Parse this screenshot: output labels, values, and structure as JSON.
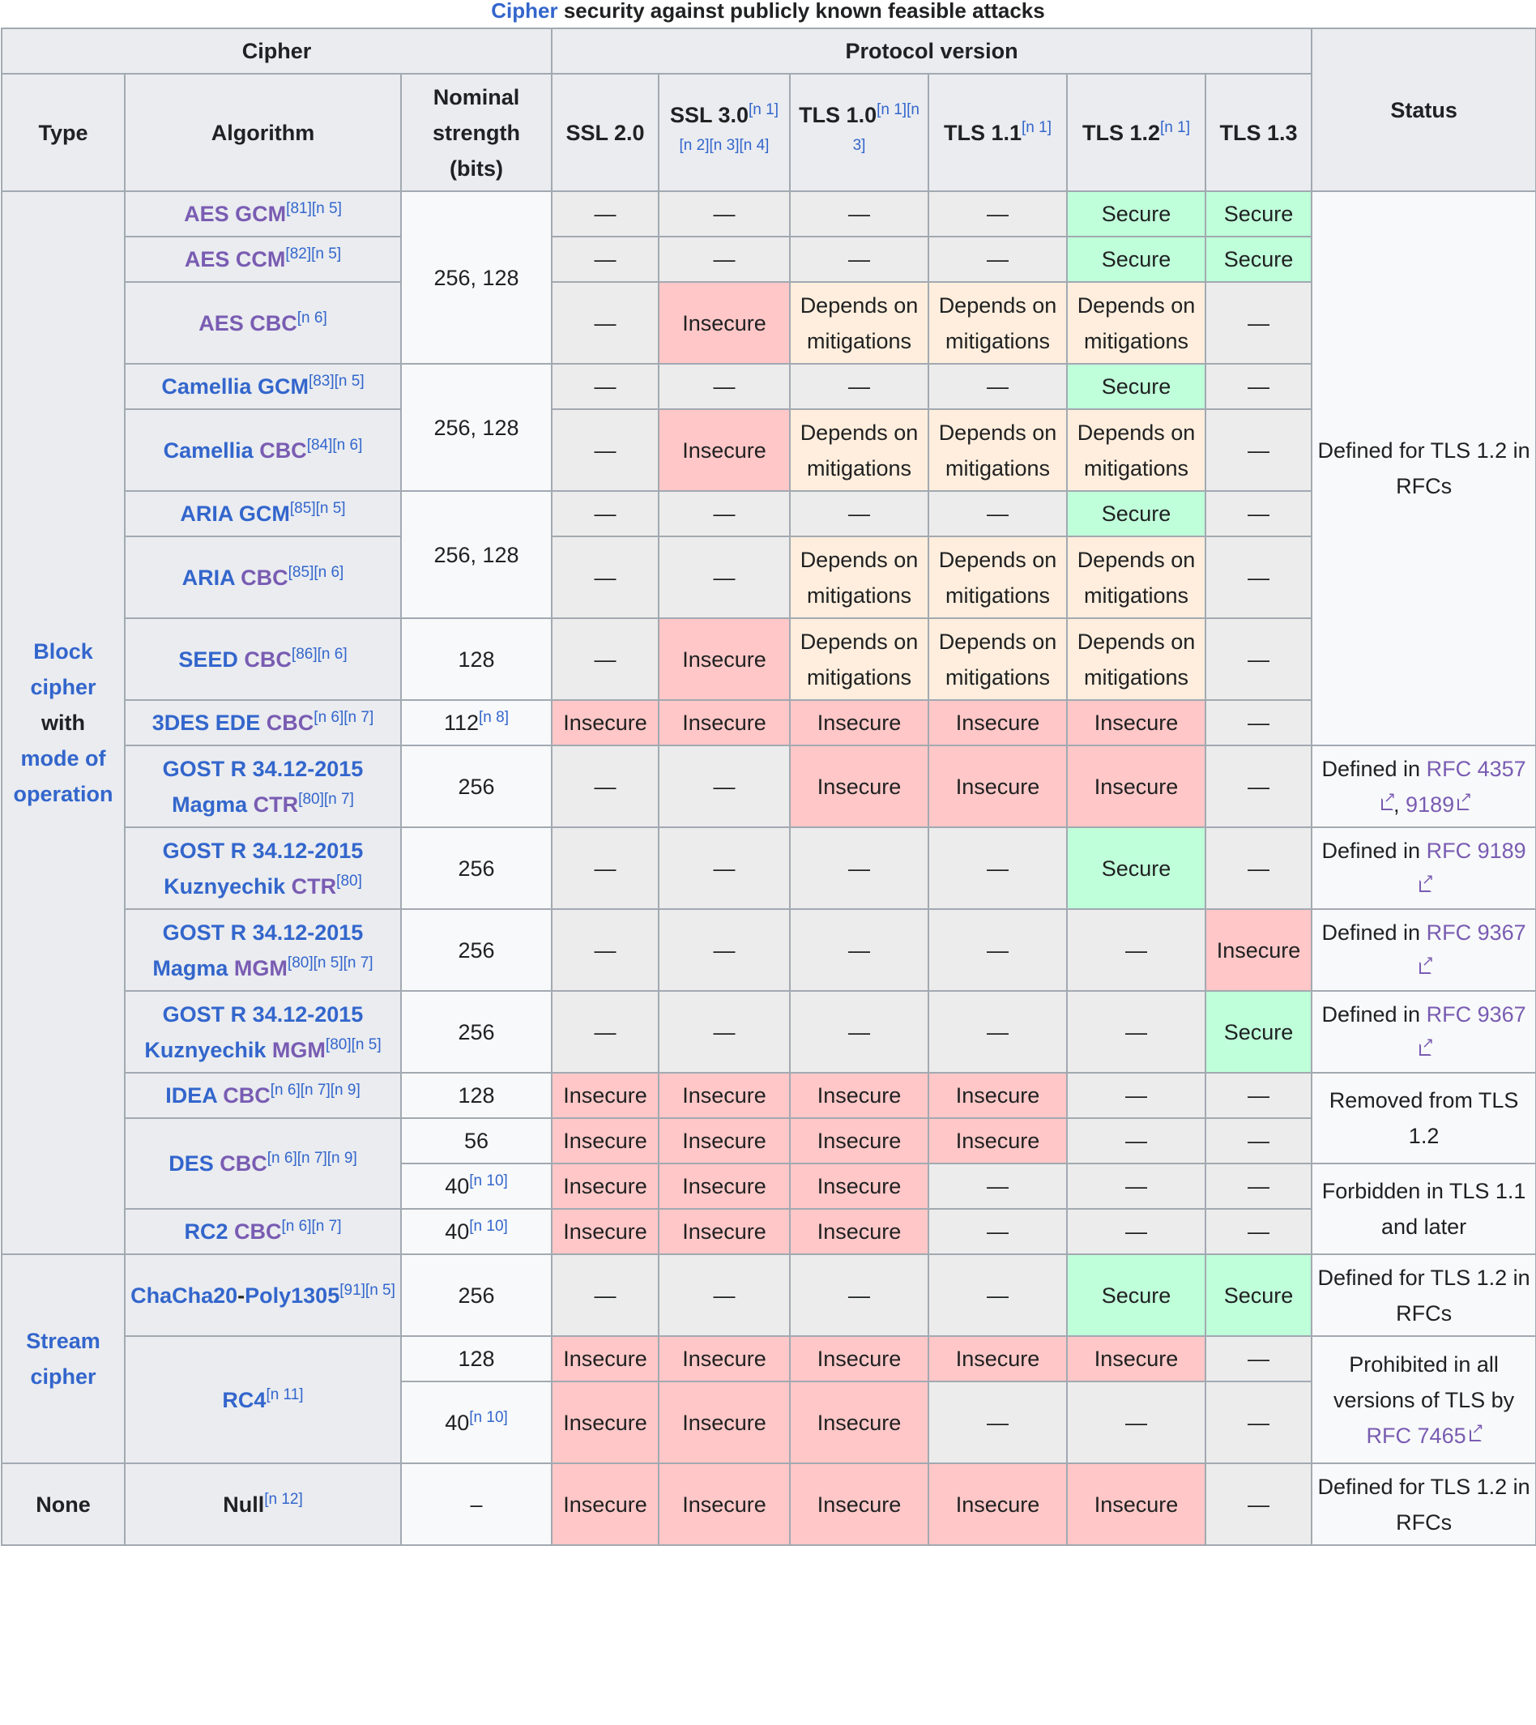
{
  "caption": {
    "link": "Cipher",
    "text": " security against publicly known feasible attacks"
  },
  "headers": {
    "cipher": "Cipher",
    "protocol_version": "Protocol version",
    "status": "Status",
    "type": "Type",
    "algorithm": "Algorithm",
    "strength": "Nominal strength (bits)",
    "versions": [
      {
        "name": "SSL 2.0",
        "refs": []
      },
      {
        "name": "SSL 3.0",
        "refs": [
          "[n 1]",
          "[n 2]",
          "[n 3]",
          "[n 4]"
        ]
      },
      {
        "name": "TLS 1.0",
        "refs": [
          "[n 1]",
          "[n 3]"
        ]
      },
      {
        "name": "TLS 1.1",
        "refs": [
          "[n 1]"
        ]
      },
      {
        "name": "TLS 1.2",
        "refs": [
          "[n 1]"
        ]
      },
      {
        "name": "TLS 1.3",
        "refs": []
      }
    ]
  },
  "types": {
    "block": [
      "Block",
      "cipher",
      "with",
      "mode of",
      "operation"
    ],
    "stream": [
      "Stream",
      "cipher"
    ],
    "none": "None"
  },
  "values": {
    "dash": "—",
    "secure": "Secure",
    "insecure": "Insecure",
    "depends": "Depends on mitigations",
    "en_dash": "–"
  },
  "rows": [
    {
      "algo": [
        {
          "t": "AES",
          "c": "vis"
        },
        {
          "t": " GCM",
          "c": "vis"
        }
      ],
      "refs": [
        "[81]",
        "[n 5]"
      ],
      "strength": "256, 128",
      "cells": [
        "na",
        "na",
        "na",
        "na",
        "sec",
        "sec"
      ]
    },
    {
      "algo": [
        {
          "t": "AES",
          "c": "vis"
        },
        {
          "t": " CCM",
          "c": "vis"
        }
      ],
      "refs": [
        "[82]",
        "[n 5]"
      ],
      "cells": [
        "na",
        "na",
        "na",
        "na",
        "sec",
        "sec"
      ]
    },
    {
      "algo": [
        {
          "t": "AES",
          "c": "vis"
        },
        {
          "t": " CBC",
          "c": "vis"
        }
      ],
      "refs": [
        "[n 6]"
      ],
      "cells": [
        "na",
        "ins",
        "dep",
        "dep",
        "dep",
        "na"
      ]
    },
    {
      "algo": [
        {
          "t": "Camellia",
          "c": "lnk"
        },
        {
          "t": " GCM",
          "c": "lnk"
        }
      ],
      "refs": [
        "[83]",
        "[n 5]"
      ],
      "strength": "256, 128",
      "cells": [
        "na",
        "na",
        "na",
        "na",
        "sec",
        "na"
      ]
    },
    {
      "algo": [
        {
          "t": "Camellia",
          "c": "lnk"
        },
        {
          "t": " CBC",
          "c": "vis"
        }
      ],
      "refs": [
        "[84]",
        "[n 6]"
      ],
      "cells": [
        "na",
        "ins",
        "dep",
        "dep",
        "dep",
        "na"
      ]
    },
    {
      "algo": [
        {
          "t": "ARIA",
          "c": "lnk"
        },
        {
          "t": " GCM",
          "c": "lnk"
        }
      ],
      "refs": [
        "[85]",
        "[n 5]"
      ],
      "strength": "256, 128",
      "cells": [
        "na",
        "na",
        "na",
        "na",
        "sec",
        "na"
      ]
    },
    {
      "algo": [
        {
          "t": "ARIA",
          "c": "lnk"
        },
        {
          "t": " CBC",
          "c": "vis"
        }
      ],
      "refs": [
        "[85]",
        "[n 6]"
      ],
      "cells": [
        "na",
        "na",
        "dep",
        "dep",
        "dep",
        "na"
      ]
    },
    {
      "algo": [
        {
          "t": "SEED",
          "c": "lnk"
        },
        {
          "t": " CBC",
          "c": "vis"
        }
      ],
      "refs": [
        "[86]",
        "[n 6]"
      ],
      "strength": "128",
      "cells": [
        "na",
        "ins",
        "dep",
        "dep",
        "dep",
        "na"
      ]
    },
    {
      "algo": [
        {
          "t": "3DES EDE",
          "c": "lnk"
        },
        {
          "t": " CBC",
          "c": "vis"
        }
      ],
      "refs": [
        "[n 6]",
        "[n 7]"
      ],
      "strength": "112",
      "strength_refs": [
        "[n 8]"
      ],
      "cells": [
        "ins",
        "ins",
        "ins",
        "ins",
        "ins",
        "na"
      ]
    },
    {
      "algo": [
        {
          "t": "GOST R 34.12-2015 Magma",
          "c": "lnk"
        },
        {
          "t": " CTR",
          "c": "vis"
        }
      ],
      "refs": [
        "[80]",
        "[n 7]"
      ],
      "strength": "256",
      "cells": [
        "na",
        "na",
        "ins",
        "ins",
        "ins",
        "na"
      ],
      "status_text": "Defined in",
      "status_links": [
        "RFC 4357",
        "9189"
      ]
    },
    {
      "algo": [
        {
          "t": "GOST R 34.12-2015 Kuznyechik",
          "c": "lnk"
        },
        {
          "t": " CTR",
          "c": "vis"
        }
      ],
      "refs": [
        "[80]"
      ],
      "strength": "256",
      "cells": [
        "na",
        "na",
        "na",
        "na",
        "sec",
        "na"
      ],
      "status_text": "Defined in",
      "status_links": [
        "RFC 9189"
      ]
    },
    {
      "algo": [
        {
          "t": "GOST R 34.12-2015 Magma",
          "c": "lnk"
        },
        {
          "t": " MGM",
          "c": "vis"
        }
      ],
      "refs": [
        "[80]",
        "[n 5]",
        "[n 7]"
      ],
      "strength": "256",
      "cells": [
        "na",
        "na",
        "na",
        "na",
        "na",
        "ins"
      ],
      "status_text": "Defined in",
      "status_links": [
        "RFC 9367"
      ]
    },
    {
      "algo": [
        {
          "t": "GOST R 34.12-2015 Kuznyechik",
          "c": "lnk"
        },
        {
          "t": " MGM",
          "c": "vis"
        }
      ],
      "refs": [
        "[80]",
        "[n 5]"
      ],
      "strength": "256",
      "cells": [
        "na",
        "na",
        "na",
        "na",
        "na",
        "sec"
      ],
      "status_text": "Defined in",
      "status_links": [
        "RFC 9367"
      ]
    },
    {
      "algo": [
        {
          "t": "IDEA",
          "c": "lnk"
        },
        {
          "t": " CBC",
          "c": "vis"
        }
      ],
      "refs": [
        "[n 6]",
        "[n 7]",
        "[n 9]"
      ],
      "strength": "128",
      "cells": [
        "ins",
        "ins",
        "ins",
        "ins",
        "na",
        "na"
      ],
      "status_text": "Removed from TLS 1.2"
    },
    {
      "algo": [
        {
          "t": "DES",
          "c": "lnk"
        },
        {
          "t": " CBC",
          "c": "vis"
        }
      ],
      "refs": [
        "[n 6]",
        "[n 7]",
        "[n 9]"
      ],
      "strength": "56",
      "cells": [
        "ins",
        "ins",
        "ins",
        "ins",
        "na",
        "na"
      ]
    },
    {
      "strength": "40",
      "strength_refs": [
        "[n 10]"
      ],
      "cells": [
        "ins",
        "ins",
        "ins",
        "na",
        "na",
        "na"
      ],
      "status_text": "Forbidden in TLS 1.1 and later"
    },
    {
      "algo": [
        {
          "t": "RC2",
          "c": "lnk"
        },
        {
          "t": " CBC",
          "c": "vis"
        }
      ],
      "refs": [
        "[n 6]",
        "[n 7]"
      ],
      "strength": "40",
      "strength_refs": [
        "[n 10]"
      ],
      "cells": [
        "ins",
        "ins",
        "ins",
        "na",
        "na",
        "na"
      ]
    },
    {
      "algo": [
        {
          "t": "ChaCha20",
          "c": "lnk"
        },
        {
          "t": "-",
          "c": "plain"
        },
        {
          "t": "Poly1305",
          "c": "lnk"
        }
      ],
      "refs": [
        "[91]",
        "[n 5]"
      ],
      "strength": "256",
      "cells": [
        "na",
        "na",
        "na",
        "na",
        "sec",
        "sec"
      ],
      "status_text": "Defined for TLS 1.2 in RFCs"
    },
    {
      "algo": [
        {
          "t": "RC4",
          "c": "lnk"
        }
      ],
      "refs": [
        "[n 11]"
      ],
      "strength": "128",
      "cells": [
        "ins",
        "ins",
        "ins",
        "ins",
        "ins",
        "na"
      ],
      "status_text": "Prohibited in all versions of TLS by",
      "status_links": [
        "RFC 7465"
      ]
    },
    {
      "strength": "40",
      "strength_refs": [
        "[n 10]"
      ],
      "cells": [
        "ins",
        "ins",
        "ins",
        "na",
        "na",
        "na"
      ]
    },
    {
      "algo": [
        {
          "t": "Null",
          "c": "plain"
        }
      ],
      "refs": [
        "[n 12]"
      ],
      "strength": "–",
      "cells": [
        "ins",
        "ins",
        "ins",
        "ins",
        "ins",
        "na"
      ],
      "status_text": "Defined for TLS 1.2 in RFCs"
    }
  ],
  "block_status": "Defined for TLS 1.2 in RFCs"
}
